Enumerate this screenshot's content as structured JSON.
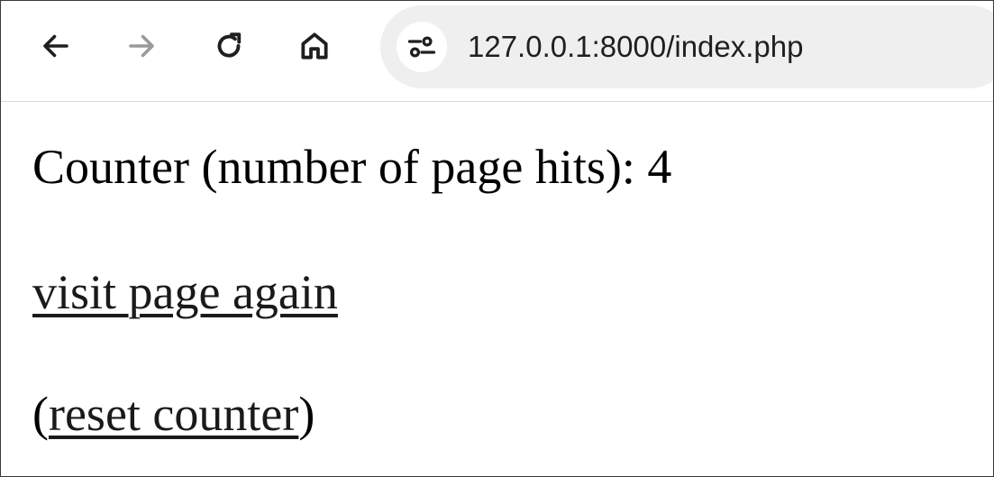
{
  "browser": {
    "back_icon": "arrow-left-icon",
    "forward_icon": "arrow-right-icon",
    "reload_icon": "reload-icon",
    "home_icon": "home-icon",
    "site_info_icon": "tune-icon",
    "url": "127.0.0.1:8000/index.php",
    "colors": {
      "icon_active": "#1f1f1f",
      "icon_disabled": "#9a9a9a",
      "omnibox_bg": "#efefef"
    }
  },
  "page": {
    "counter_text": "Counter (number of page hits): 4",
    "visit_link": "visit page again",
    "reset_open": "(",
    "reset_link": "reset counter",
    "reset_close": ")"
  }
}
